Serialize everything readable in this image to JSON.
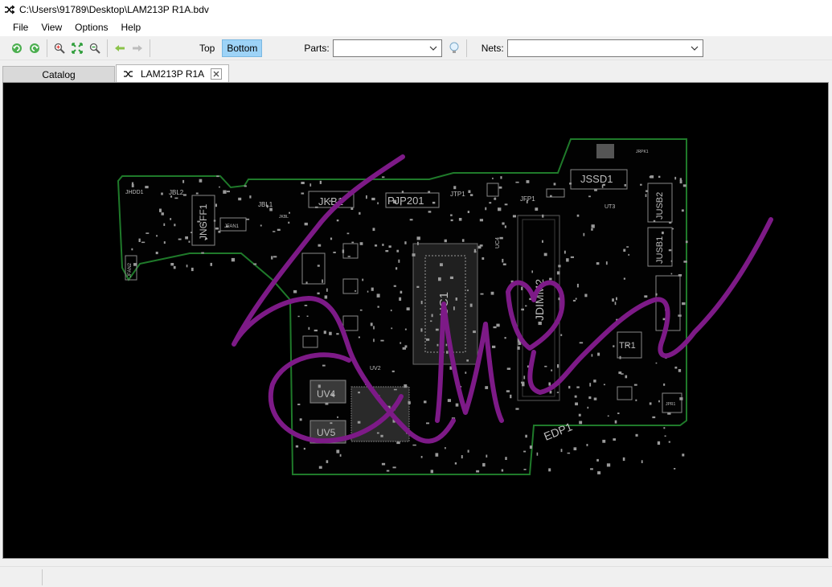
{
  "window": {
    "title": "C:\\Users\\91789\\Desktop\\LAM213P R1A.bdv"
  },
  "menu": {
    "items": [
      "File",
      "View",
      "Options",
      "Help"
    ]
  },
  "toolbar": {
    "top_label": "Top",
    "bottom_label": "Bottom",
    "parts_label": "Parts:",
    "nets_label": "Nets:",
    "parts_value": "",
    "nets_value": "",
    "active_layer": "Bottom"
  },
  "tabs": [
    {
      "label": "Catalog",
      "active": false
    },
    {
      "label": "LAM213P R1A",
      "active": true
    }
  ],
  "board": {
    "labels": {
      "jkb": "JKB1",
      "pjp": "PJP201",
      "jtp": "JTP1",
      "jfp": "JFP1",
      "jssd": "JSSD1",
      "jngff": "JNGFF1",
      "jdimm": "JDIMM2",
      "juc": "UC1",
      "jusb1": "JUSB1",
      "jusb2": "JUSB2",
      "tr": "TR1",
      "uv4": "UV4",
      "uv5": "UV5",
      "edp": "EDP1",
      "jhdd": "JHDD1",
      "jbl2": "JBL2",
      "jbl1": "JBL1",
      "jfan1": "JFAN1",
      "jfan2": "JFAN2",
      "ut3": "UT3",
      "uc4": "UC4",
      "jkbl": "JKBL",
      "uv2": "UV2",
      "jrpk": "JRPK1",
      "jpr": "JPR1"
    },
    "colors": {
      "background": "#000000",
      "outline": "#1f7a2a",
      "annotation": "#7d1a87",
      "silk": "#bfbfbf"
    }
  }
}
